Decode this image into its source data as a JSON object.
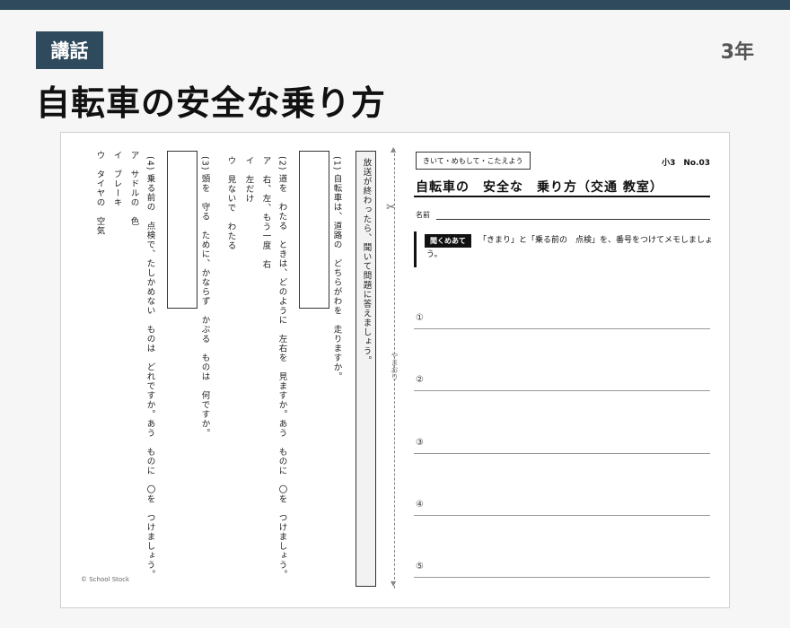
{
  "header": {
    "category": "講話",
    "grade": "3年",
    "title": "自転車の安全な乗り方"
  },
  "worksheet": {
    "instruction": "放送が終わったら、聞いて問題に答えましょう。",
    "questions": [
      {
        "number": "(1)",
        "text": "自転車は、道路の　どちらがわを　走りますか。"
      },
      {
        "number": "(2)",
        "text": "道を　わたる　ときは、どのように　左右を　見ますか。あう　ものに　〇を　つけましょう。",
        "options": [
          "ア　右、左、もう一度　右",
          "イ　左だけ",
          "ウ　見ないで　わたる"
        ]
      },
      {
        "number": "(3)",
        "text": "頭を　守る　ために、かならず　かぶる　ものは　何ですか。"
      },
      {
        "number": "(4)",
        "text": "乗る前の　点検で、たしかめない　ものは　どれですか。あう　ものに　〇を　つけましょう。",
        "options": [
          "ア　サドルの　色",
          "イ　ブレーキ",
          "ウ　タイヤの　空気"
        ]
      }
    ],
    "fold_label": "やまおり",
    "copyright": "© School Stock",
    "tag": "きいて・めもして・こたえよう",
    "code": "小3　No.03",
    "title": "自転車の　安全な　乗り方（交通 教室）",
    "name_label": "名前",
    "listen_badge": "聞くめあて",
    "listen_text": "「きまり」と「乗る前の　点検」を、番号をつけてメモしましょ",
    "listen_text2": "う。",
    "memo_numbers": [
      "①",
      "②",
      "③",
      "④",
      "⑤"
    ]
  }
}
